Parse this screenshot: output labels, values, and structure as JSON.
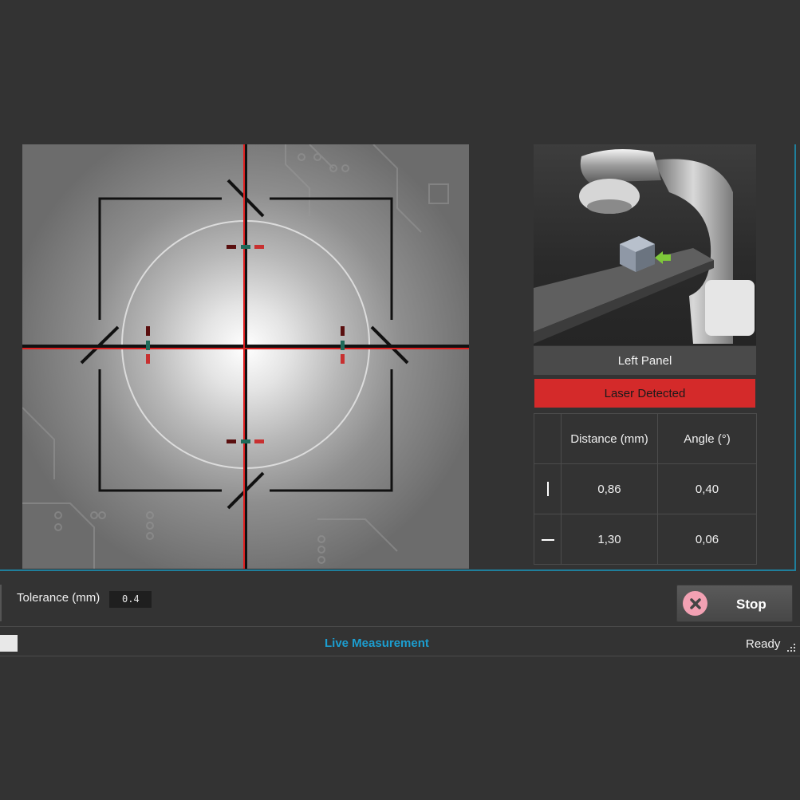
{
  "viewer": {
    "crosshair_color": "#e02020",
    "frame_color": "#111111"
  },
  "preview": {
    "title": "Left Panel"
  },
  "status": {
    "laser": "Laser Detected",
    "laser_color": "#d42a2a"
  },
  "measurements": {
    "headers": [
      "Distance (mm)",
      "Angle (°)"
    ],
    "rows": [
      {
        "icon": "vertical-line-icon",
        "distance": "0,86",
        "angle": "0,40"
      },
      {
        "icon": "horizontal-line-icon",
        "distance": "1,30",
        "angle": "0,06"
      }
    ]
  },
  "controls": {
    "tolerance_label": "Tolerance (mm)",
    "tolerance_value": "0.4",
    "stop_label": "Stop",
    "stop_icon": "close-icon"
  },
  "statusbar": {
    "mode": "Live Measurement",
    "state": "Ready",
    "mode_color": "#1c9ed0"
  }
}
